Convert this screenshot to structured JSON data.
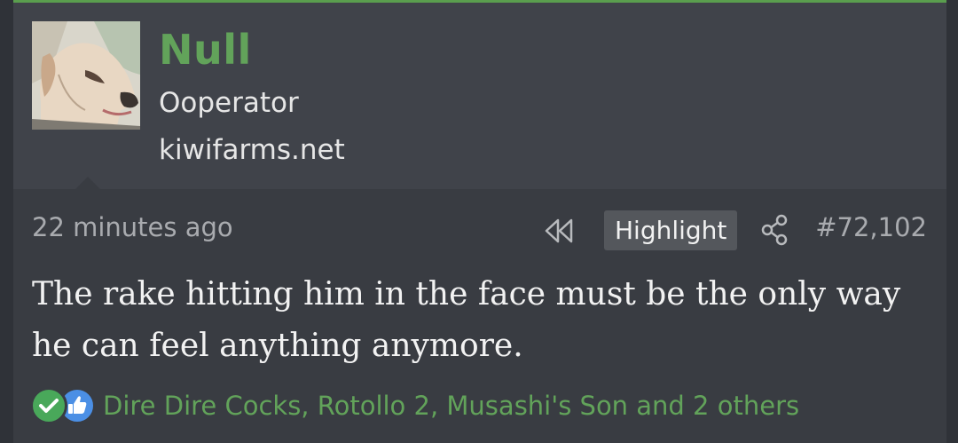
{
  "user": {
    "name": "Null",
    "title": "Ooperator",
    "site": "kiwifarms.net"
  },
  "post": {
    "time": "22 minutes ago",
    "highlight_label": "Highlight",
    "number": "#72,102",
    "message": "The rake hitting him in the face must be the only way he can feel anything anymore."
  },
  "reactions": {
    "summary": "Dire Dire Cocks, Rotollo 2, Musashi's Son and 2 others",
    "icons": [
      "check-reaction-icon",
      "thumbs-up-reaction-icon"
    ]
  },
  "colors": {
    "accent_green": "#62a35a",
    "top_border": "#5a9e4e",
    "post_bg": "#393c42",
    "user_block_bg": "#40434a"
  }
}
